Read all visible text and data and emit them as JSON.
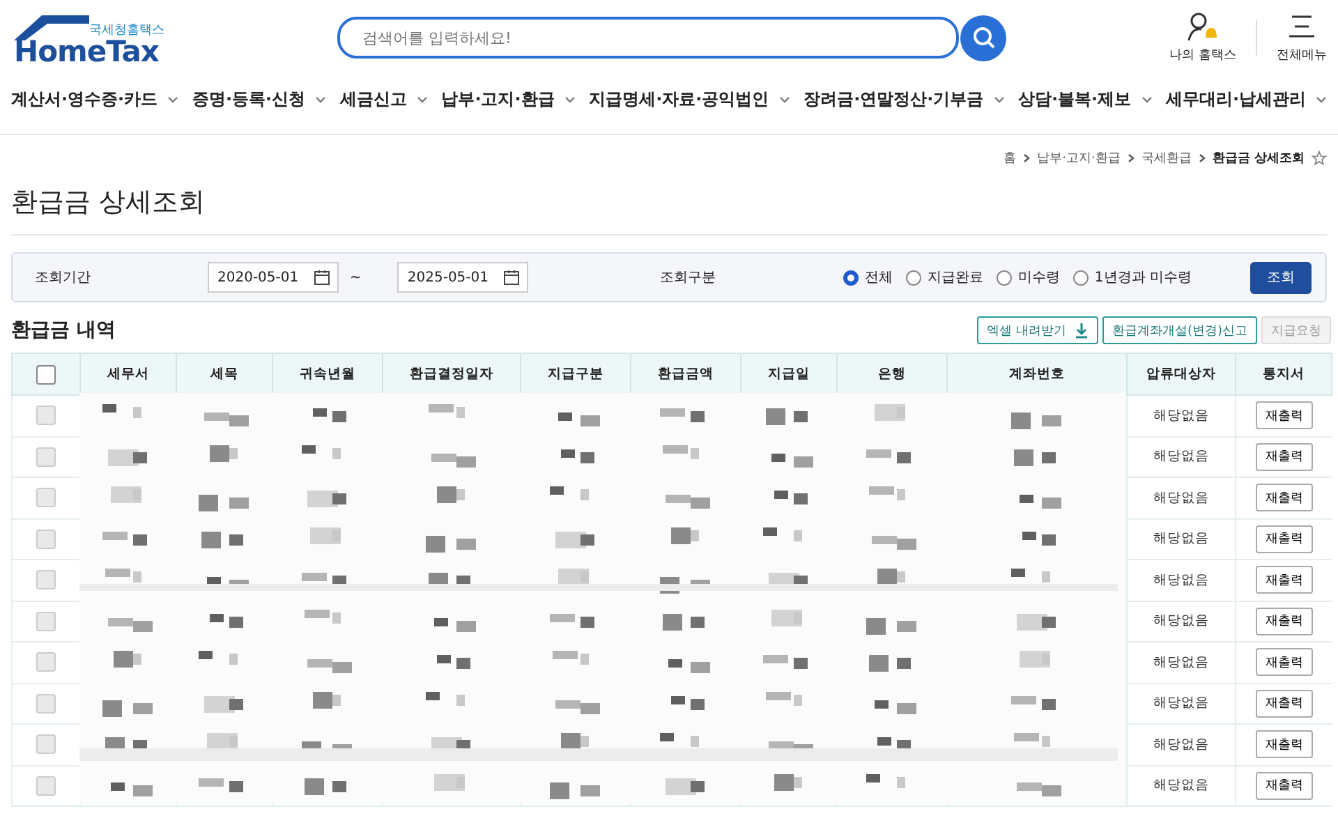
{
  "logo": {
    "tagline": "국세청홈택스",
    "name": "HomeTax"
  },
  "search": {
    "placeholder": "검색어를 입력하세요!"
  },
  "header_links": [
    {
      "label": "나의 홈택스",
      "kind": "user"
    },
    {
      "label": "전체메뉴",
      "kind": "menu"
    }
  ],
  "nav": [
    "계산서·영수증·카드",
    "증명·등록·신청",
    "세금신고",
    "납부·고지·환급",
    "지급명세·자료·공익법인",
    "장려금·연말정산·기부금",
    "상담·불복·제보",
    "세무대리·납세관리"
  ],
  "breadcrumb": [
    "홈",
    "납부·고지·환급",
    "국세환급",
    "환급금 상세조회"
  ],
  "page_title": "환급금 상세조회",
  "filter": {
    "period_label": "조회기간",
    "from": "2020-05-01",
    "separator": "~",
    "to": "2025-05-01",
    "type_label": "조회구분",
    "options": [
      {
        "label": "전체",
        "selected": true
      },
      {
        "label": "지급완료",
        "selected": false
      },
      {
        "label": "미수령",
        "selected": false
      },
      {
        "label": "1년경과 미수령",
        "selected": false
      }
    ],
    "submit": "조회"
  },
  "section_title": "환급금 내역",
  "actions": [
    {
      "label": "엑셀 내려받기",
      "kind": "download",
      "disabled": false
    },
    {
      "label": "환급계좌개설(변경)신고",
      "kind": "plain",
      "disabled": false
    },
    {
      "label": "지급요청",
      "kind": "plain",
      "disabled": true
    }
  ],
  "table": {
    "select_all": {
      "checked": false
    },
    "columns": [
      "세무서",
      "세목",
      "귀속년월",
      "환급결정일자",
      "지급구분",
      "환급금액",
      "지급일",
      "은행",
      "계좌번호",
      "압류대상자",
      "통지서"
    ],
    "rows": [
      {
        "checked": false,
        "seizure": "해당없음",
        "notice": "재출력"
      },
      {
        "checked": false,
        "seizure": "해당없음",
        "notice": "재출력"
      },
      {
        "checked": false,
        "seizure": "해당없음",
        "notice": "재출력"
      },
      {
        "checked": false,
        "seizure": "해당없음",
        "notice": "재출력"
      },
      {
        "checked": false,
        "seizure": "해당없음",
        "notice": "재출력"
      },
      {
        "checked": false,
        "seizure": "해당없음",
        "notice": "재출력"
      },
      {
        "checked": false,
        "seizure": "해당없음",
        "notice": "재출력"
      },
      {
        "checked": false,
        "seizure": "해당없음",
        "notice": "재출력"
      },
      {
        "checked": false,
        "seizure": "해당없음",
        "notice": "재출력"
      },
      {
        "checked": false,
        "seizure": "해당없음",
        "notice": "재출력"
      }
    ]
  }
}
